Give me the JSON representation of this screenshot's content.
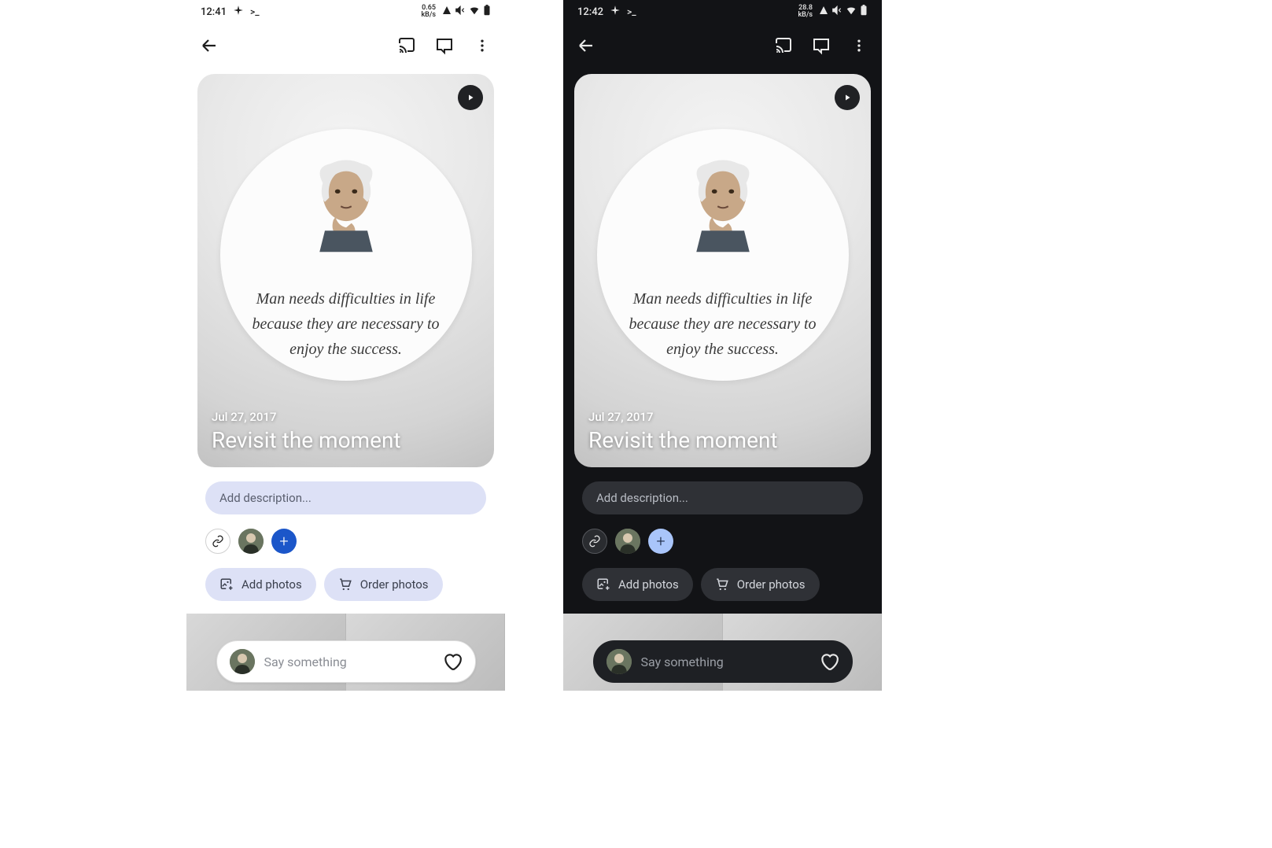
{
  "screens": {
    "light": {
      "status": {
        "time": "12:41",
        "net_speed": "0.65",
        "net_unit": "kB/s"
      },
      "hero": {
        "date": "Jul 27, 2017",
        "title": "Revisit the moment",
        "quote": "Man needs difficulties in life\nbecause they are necessary to\nenjoy the success."
      },
      "description": {
        "placeholder": "Add description..."
      },
      "actions": {
        "add_photos": "Add photos",
        "order_photos": "Order photos"
      },
      "comment": {
        "placeholder": "Say something"
      }
    },
    "dark": {
      "status": {
        "time": "12:42",
        "net_speed": "28.8",
        "net_unit": "kB/s"
      },
      "hero": {
        "date": "Jul 27, 2017",
        "title": "Revisit the moment",
        "quote": "Man needs difficulties in life\nbecause they are necessary to\nenjoy the success."
      },
      "description": {
        "placeholder": "Add description..."
      },
      "actions": {
        "add_photos": "Add photos",
        "order_photos": "Order photos"
      },
      "comment": {
        "placeholder": "Say something"
      }
    }
  },
  "icons": {
    "back": "back-arrow-icon",
    "cast": "cast-icon",
    "comment": "comment-icon",
    "more": "more-vert-icon",
    "play": "play-icon",
    "link": "link-icon",
    "plus": "plus-icon",
    "add_photo": "add-photo-icon",
    "cart": "cart-icon",
    "heart": "heart-outline-icon"
  }
}
